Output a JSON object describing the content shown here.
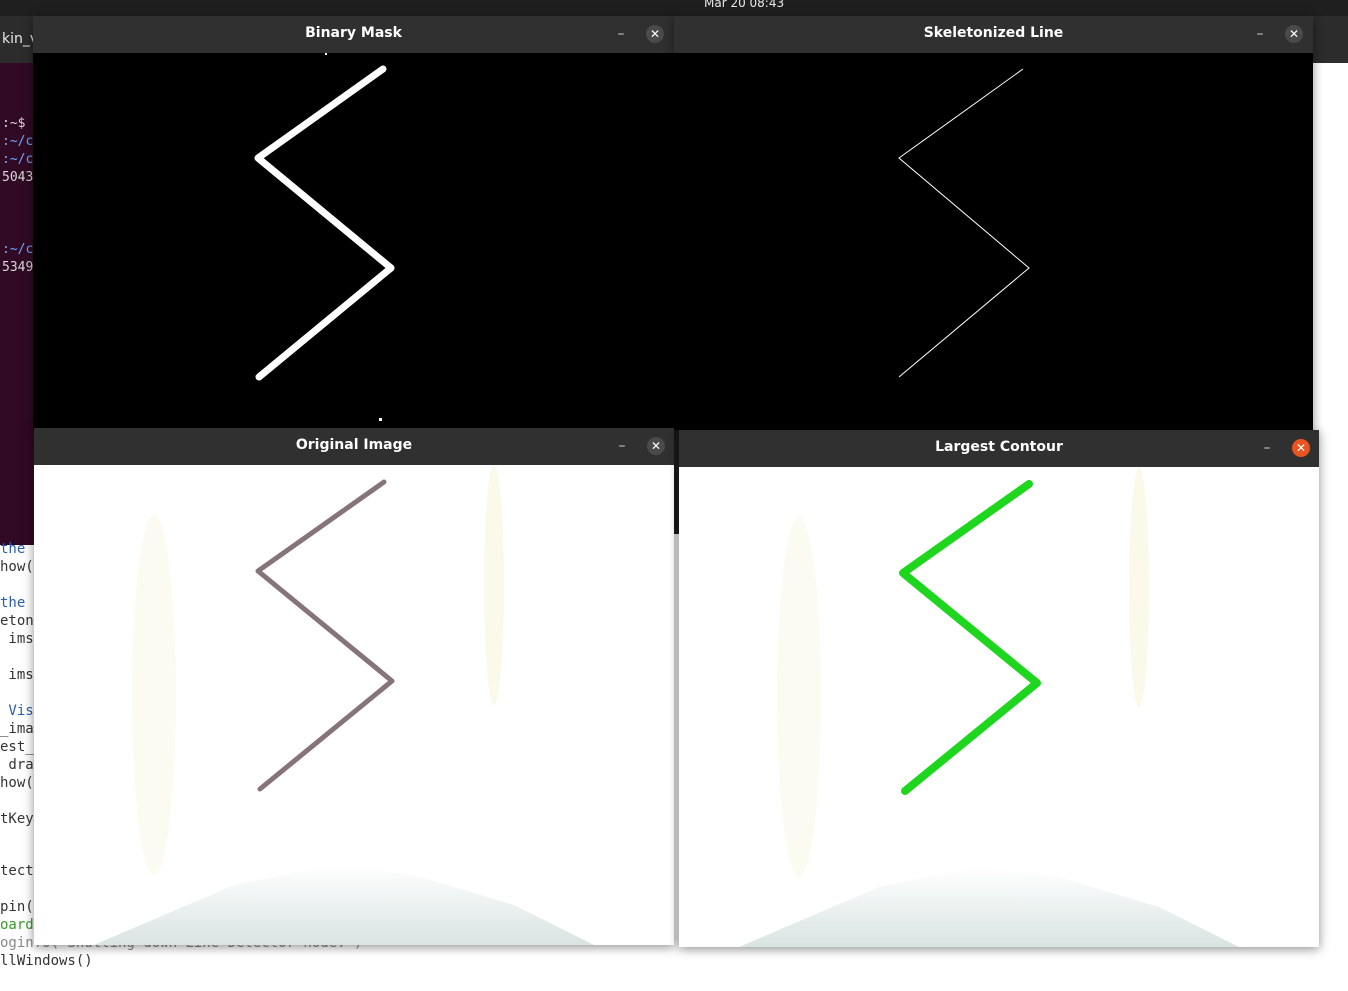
{
  "system": {
    "clock": "Mar 20  08:43"
  },
  "background": {
    "tab_text": "kin_v",
    "terminal_lines": [
      ":~$",
      ":~/c",
      ":~/c",
      "5043",
      ":~/c",
      "5349"
    ],
    "code_lines": [
      "the l",
      "how('",
      "the s",
      "eton",
      " imsh",
      " imsh",
      " Visu",
      "_imag",
      "est_c",
      " draw",
      "how('",
      "tKey(",
      "tecto",
      "pin()",
      "oardI",
      "oginfo(\"Shutting down Line Detector node.\")",
      "llWindows()"
    ]
  },
  "windows": [
    {
      "title": "Binary Mask",
      "minimize_label": "–",
      "close_label": "✕"
    },
    {
      "title": "Skeletonized Line",
      "minimize_label": "–",
      "close_label": "✕"
    },
    {
      "title": "Original Image",
      "minimize_label": "–",
      "close_label": "✕"
    },
    {
      "title": "Largest Contour",
      "minimize_label": "–",
      "close_label": "✕"
    }
  ],
  "colors": {
    "mask_line": "#ffffff",
    "skeleton_line": "#ffffff",
    "original_line": "#857478",
    "contour_line": "#1fd61f",
    "close_active": "#e95420"
  },
  "icons": {
    "minimize": "minimize-icon",
    "close": "close-icon"
  }
}
